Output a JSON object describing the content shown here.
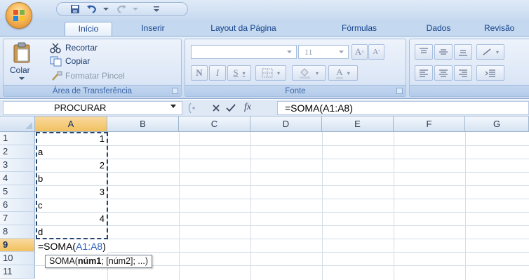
{
  "app": {
    "quick_access": [
      "save-icon",
      "undo-icon",
      "redo-icon",
      "customize-icon"
    ]
  },
  "tabs": [
    {
      "label": "Início",
      "active": true
    },
    {
      "label": "Inserir"
    },
    {
      "label": "Layout da Página"
    },
    {
      "label": "Fórmulas"
    },
    {
      "label": "Dados"
    },
    {
      "label": "Revisão"
    }
  ],
  "ribbon": {
    "clipboard": {
      "group_label": "Área de Transferência",
      "paste_label": "Colar",
      "cut_label": "Recortar",
      "copy_label": "Copiar",
      "format_painter_label": "Formatar Pincel"
    },
    "font": {
      "group_label": "Fonte",
      "font_name_value": "",
      "font_size_value": "11",
      "bold_glyph": "N",
      "italic_glyph": "I",
      "underline_glyph": "S",
      "grow_glyph": "A",
      "shrink_glyph": "A",
      "font_color_glyph": "A"
    },
    "alignment": {
      "group_label": ""
    }
  },
  "formula_bar": {
    "name_box": "PROCURAR",
    "fx_label": "fx",
    "formula": "=SOMA(A1:A8)"
  },
  "sheet": {
    "columns": [
      "A",
      "B",
      "C",
      "D",
      "E",
      "F",
      "G"
    ],
    "selected_column": "A",
    "rows": [
      "1",
      "2",
      "3",
      "4",
      "5",
      "6",
      "7",
      "8",
      "9",
      "10",
      "11"
    ],
    "selected_row": "9",
    "cells": {
      "A1": "1",
      "A2": "a",
      "A3": "2",
      "A4": "b",
      "A5": "3",
      "A6": "c",
      "A7": "4",
      "A8": "d"
    },
    "editing": {
      "prefix": "=SOMA(",
      "ref": "A1:A8",
      "suffix": ")"
    },
    "tooltip": {
      "func": "SOMA(",
      "arg1": "núm1",
      "rest": "; [núm2]; ...)"
    }
  },
  "colors": {
    "ribbon_bg": "#dae6f6",
    "tab_text": "#15428b",
    "header_selected": "#f1c15f",
    "range_ref": "#2e5fbf"
  }
}
